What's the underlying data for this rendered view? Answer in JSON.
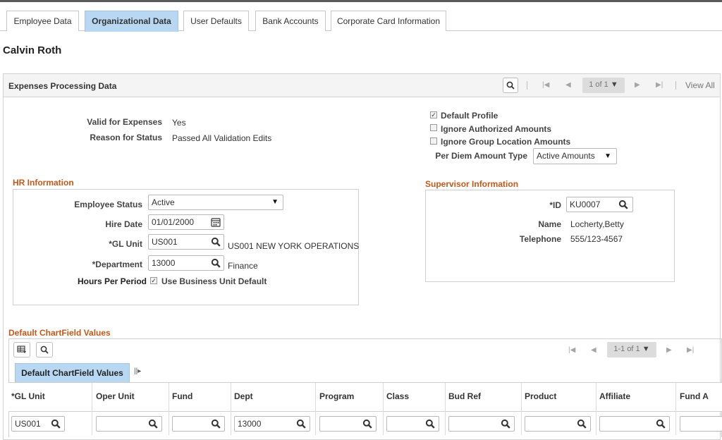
{
  "tabs": [
    {
      "label": "Employee Data",
      "active": false
    },
    {
      "label": "Organizational Data",
      "active": true
    },
    {
      "label": "User Defaults",
      "active": false
    },
    {
      "label": "Bank Accounts",
      "active": false
    },
    {
      "label": "Corporate Card Information",
      "active": false
    }
  ],
  "person_name": "Calvin Roth",
  "section": {
    "title": "Expenses Processing Data",
    "pager": "1 of 1",
    "view_all": "View All"
  },
  "validation": {
    "valid_label": "Valid for Expenses",
    "valid_value": "Yes",
    "reason_label": "Reason for Status",
    "reason_value": "Passed All Validation Edits"
  },
  "options": {
    "default_profile": {
      "label": "Default Profile",
      "checked": true
    },
    "ignore_authorized": {
      "label": "Ignore Authorized Amounts",
      "checked": false
    },
    "ignore_group": {
      "label": "Ignore Group Location Amounts",
      "checked": false
    },
    "per_diem_label": "Per Diem Amount Type",
    "per_diem_value": "Active Amounts"
  },
  "hr": {
    "heading": "HR Information",
    "status_label": "Employee Status",
    "status_value": "Active",
    "hire_label": "Hire Date",
    "hire_value": "01/01/2000",
    "gl_label": "*GL Unit",
    "gl_value": "US001",
    "gl_desc": "US001 NEW YORK OPERATIONS",
    "dept_label": "*Department",
    "dept_value": "13000",
    "dept_desc": "Finance",
    "hours_label": "Hours Per Period",
    "hours_option": "Use Business Unit Default",
    "hours_checked": true
  },
  "supervisor": {
    "heading": "Supervisor Information",
    "id_label": "*ID",
    "id_value": "KU0007",
    "name_label": "Name",
    "name_value": "Locherty,Betty",
    "phone_label": "Telephone",
    "phone_value": "555/123-4567"
  },
  "chartfield": {
    "heading": "Default ChartField Values",
    "pager": "1-1 of 1",
    "subtab": "Default ChartField Values",
    "columns": [
      "*GL Unit",
      "Oper Unit",
      "Fund",
      "Dept",
      "Program",
      "Class",
      "Bud Ref",
      "Product",
      "Affiliate",
      "Fund A"
    ],
    "row": [
      "US001",
      "",
      "",
      "13000",
      "",
      "",
      "",
      "",
      "",
      ""
    ]
  },
  "colors": {
    "active_tab": "#b8d7f2",
    "subheading": "#c2591b",
    "panel_header": "#f4f4f4"
  }
}
